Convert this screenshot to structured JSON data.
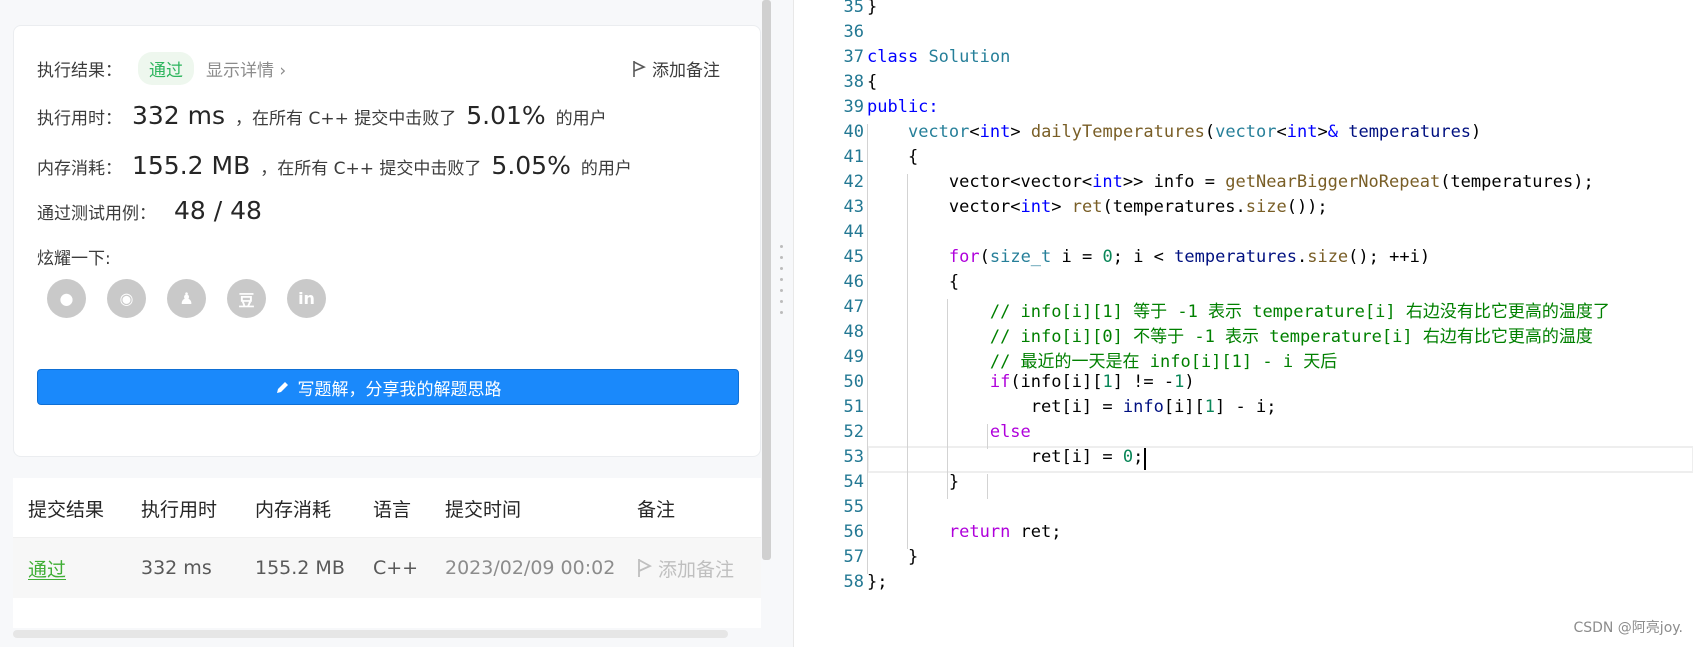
{
  "result": {
    "status_label": "执行结果：",
    "status_value": "通过",
    "detail_link": "显示详情 ›",
    "add_note": "添加备注",
    "time_label": "执行用时：",
    "time_value": "332 ms",
    "time_mid": "，在所有 C++ 提交中击败了",
    "time_pct": "5.01%",
    "time_suffix": "的用户",
    "mem_label": "内存消耗：",
    "mem_value": "155.2 MB",
    "mem_mid": "，在所有 C++ 提交中击败了",
    "mem_pct": "5.05%",
    "mem_suffix": "的用户",
    "tests_label": "通过测试用例：",
    "tests_value": "48 / 48",
    "share_label": "炫耀一下:",
    "social": [
      {
        "name": "wechat-icon",
        "glyph": "●"
      },
      {
        "name": "weibo-icon",
        "glyph": "◉"
      },
      {
        "name": "qq-icon",
        "glyph": "♟"
      },
      {
        "name": "douban-icon",
        "glyph": "豆"
      },
      {
        "name": "linkedin-icon",
        "glyph": "in"
      }
    ],
    "write_button": "写题解，分享我的解题思路"
  },
  "table": {
    "headers": [
      "提交结果",
      "执行用时",
      "内存消耗",
      "语言",
      "提交时间",
      "备注"
    ],
    "row": [
      "通过",
      "332 ms",
      "155.2 MB",
      "C++",
      "2023/02/09 00:02",
      "添加备注"
    ]
  },
  "editor": {
    "lines": [
      {
        "n": "35",
        "html": "}"
      },
      {
        "n": "36",
        "html": ""
      },
      {
        "n": "37",
        "html": "<span class='kw'>class</span> <span class='ty'>Solution</span>"
      },
      {
        "n": "38",
        "html": "{"
      },
      {
        "n": "39",
        "html": "<span class='kw'>public:</span>"
      },
      {
        "n": "40",
        "html": "    <span class='ty'>vector</span>&lt;<span class='kw'>int</span>&gt; <span class='fn'>dailyTemperatures</span>(<span class='ty'>vector</span>&lt;<span class='kw'>int</span>&gt;<span class='kw'>&amp;</span> <span class='pv'>temperatures</span>)"
      },
      {
        "n": "41",
        "html": "    {"
      },
      {
        "n": "42",
        "html": "        vector&lt;vector&lt;<span class='kw'>int</span>&gt;&gt; info = <span class='fn'>getNearBiggerNoRepeat</span>(temperatures);"
      },
      {
        "n": "43",
        "html": "        vector&lt;<span class='kw'>int</span>&gt; <span class='fn'>ret</span>(temperatures.<span class='fn'>size</span>());"
      },
      {
        "n": "44",
        "html": ""
      },
      {
        "n": "45",
        "html": "        <span class='ctl'>for</span>(<span class='ty'>size_t</span> i = <span class='num'>0</span>; i &lt; <span class='pv'>temperatures</span>.<span class='fn'>size</span>(); ++i)"
      },
      {
        "n": "46",
        "html": "        {"
      },
      {
        "n": "47",
        "html": "            <span class='cm'>// info[i][1] 等于 -1 表示 temperature[i] 右边没有比它更高的温度了</span>"
      },
      {
        "n": "48",
        "html": "            <span class='cm'>// info[i][0] 不等于 -1 表示 temperature[i] 右边有比它更高的温度</span>"
      },
      {
        "n": "49",
        "html": "            <span class='cm'>// 最近的一天是在 info[i][1] - i 天后</span>"
      },
      {
        "n": "50",
        "html": "            <span class='ctl'>if</span>(info[i][<span class='num'>1</span>] != -<span class='num'>1</span>)"
      },
      {
        "n": "51",
        "html": "                ret[i] = <span class='pv'>info</span>[i][<span class='num'>1</span>] - i;"
      },
      {
        "n": "52",
        "html": "            <span class='ctl'>else</span>"
      },
      {
        "n": "53",
        "html": "                ret[i] = <span class='num'>0</span>;"
      },
      {
        "n": "54",
        "html": "        }"
      },
      {
        "n": "55",
        "html": ""
      },
      {
        "n": "56",
        "html": "        <span class='ctl'>return</span> ret;"
      },
      {
        "n": "57",
        "html": "    }"
      },
      {
        "n": "58",
        "html": "};"
      }
    ],
    "current_line": "53",
    "watermark": "CSDN @阿亮joy."
  },
  "colors": {
    "accent": "#1a89fb",
    "pass": "#2db55d"
  }
}
